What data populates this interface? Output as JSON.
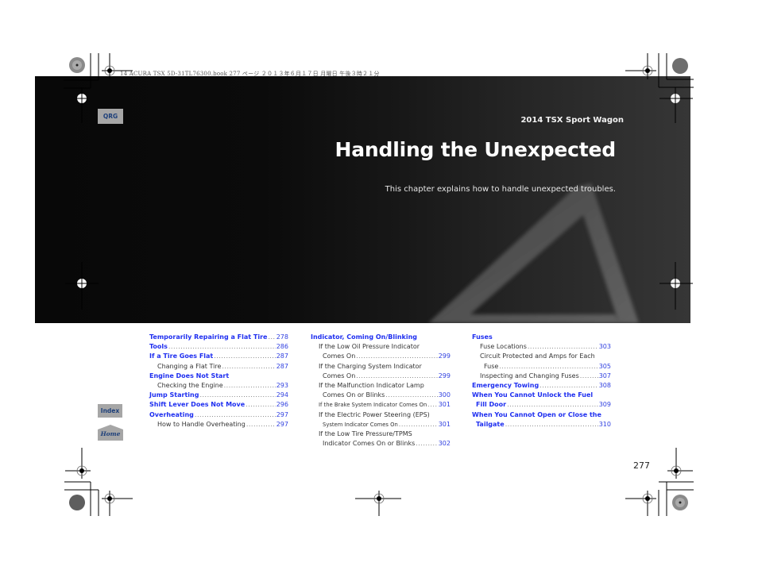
{
  "print_header": "14 ACURA TSX 5D-31TL76300.book  277 ページ  ２０１３年６月１７日  月曜日  午後３時２１分",
  "banner": {
    "model": "2014 TSX Sport Wagon",
    "title": "Handling the Unexpected",
    "description": "This chapter explains how to handle unexpected troubles."
  },
  "side_tabs": {
    "qrg": "QRG",
    "index": "Index",
    "home": "Home"
  },
  "colors": {
    "link_blue": "#1f2ff0",
    "tab_gray": "#a6a6a6",
    "tab_text": "#1d3f7a"
  },
  "toc": {
    "columns": [
      [
        {
          "text": "Temporarily Repairing a Flat Tire",
          "page": "278",
          "level": 1
        },
        {
          "text": "Tools",
          "page": "286",
          "level": 1
        },
        {
          "text": "If a Tire Goes Flat",
          "page": "287",
          "level": 1
        },
        {
          "text": "Changing a Flat Tire",
          "page": "287",
          "level": 2
        },
        {
          "text": "Engine Does Not Start",
          "page": "",
          "level": 1
        },
        {
          "text": "Checking the Engine",
          "page": "293",
          "level": 2
        },
        {
          "text": "Jump Starting",
          "page": "294",
          "level": 1
        },
        {
          "text": "Shift Lever Does Not Move",
          "page": "296",
          "level": 1
        },
        {
          "text": "Overheating",
          "page": "297",
          "level": 1
        },
        {
          "text": "How to Handle Overheating",
          "page": "297",
          "level": 2
        }
      ],
      [
        {
          "text": "Indicator, Coming On/Blinking",
          "page": "",
          "level": 1
        },
        {
          "text": "If the Low Oil Pressure Indicator",
          "page": "",
          "level": 2
        },
        {
          "text": "Comes On",
          "page": "299",
          "level": 3
        },
        {
          "text": "If the Charging System Indicator",
          "page": "",
          "level": 2
        },
        {
          "text": "Comes On",
          "page": "299",
          "level": 3
        },
        {
          "text": "If the Malfunction Indicator Lamp",
          "page": "",
          "level": 2
        },
        {
          "text": "Comes On or Blinks",
          "page": "300",
          "level": 3
        },
        {
          "text": "If the Brake System Indicator Comes On",
          "page": "301",
          "level": 2
        },
        {
          "text": "If the Electric Power Steering (EPS)",
          "page": "",
          "level": 2
        },
        {
          "text": "System Indicator Comes On",
          "page": "301",
          "level": 3
        },
        {
          "text": "If the Low Tire Pressure/TPMS",
          "page": "",
          "level": 2
        },
        {
          "text": "Indicator Comes On or Blinks",
          "page": "302",
          "level": 3
        }
      ],
      [
        {
          "text": "Fuses",
          "page": "",
          "level": 1
        },
        {
          "text": "Fuse Locations",
          "page": "303",
          "level": 2
        },
        {
          "text": "Circuit Protected and Amps for Each",
          "page": "",
          "level": 2
        },
        {
          "text": "Fuse",
          "page": "305",
          "level": 3
        },
        {
          "text": "Inspecting and Changing Fuses",
          "page": "307",
          "level": 2
        },
        {
          "text": "Emergency Towing",
          "page": "308",
          "level": 1
        },
        {
          "text": "When You Cannot Unlock the Fuel",
          "page": "",
          "level": 1
        },
        {
          "text": "Fill  Door",
          "page": "309",
          "level": 4
        },
        {
          "text": "When You Cannot Open or Close the",
          "page": "",
          "level": 1
        },
        {
          "text": "Tailgate",
          "page": "310",
          "level": 4
        }
      ]
    ]
  },
  "page_number": "277"
}
